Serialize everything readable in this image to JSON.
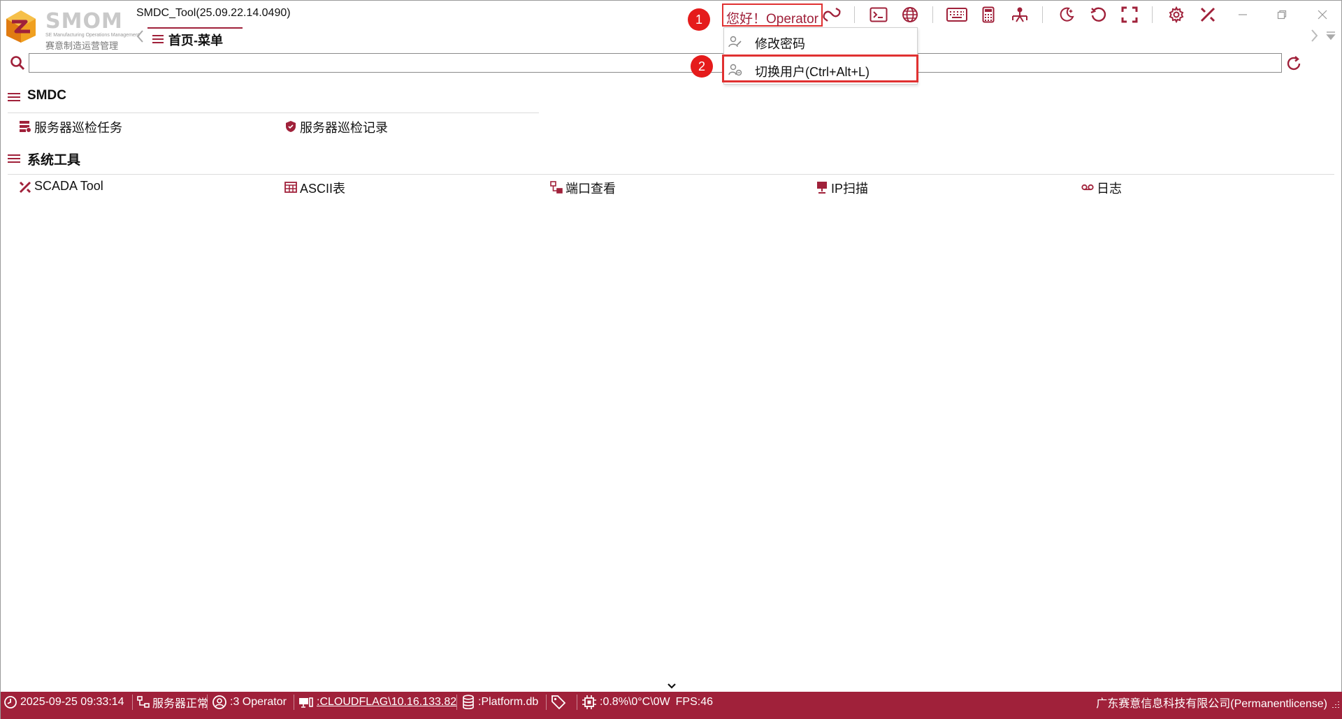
{
  "window": {
    "app_title": "SMDC_Tool(25.09.22.14.0490)",
    "brand_text": "SMOM",
    "brand_sub": "SE Manufacturing Operations Management",
    "brand_cn": "赛意制造运营管理",
    "accent_color": "#a0213a",
    "highlight_color": "#e03131",
    "controls": [
      "minimize-icon",
      "restore-icon",
      "close-icon"
    ]
  },
  "tabs": [
    {
      "label": "首页-菜单",
      "active": true
    }
  ],
  "header": {
    "greeting": "您好！Operator",
    "toolbar_icons": [
      "link-icon",
      "terminal-icon",
      "globe-icon",
      "keyboard-icon",
      "calculator-icon",
      "network-icon",
      "moon-icon",
      "undo-icon",
      "fullscreen-icon",
      "gear-icon",
      "tools-icon"
    ]
  },
  "annotations": {
    "step1": "1",
    "step2": "2"
  },
  "user_menu": {
    "items": [
      {
        "label": "修改密码",
        "icon": "edit-user-icon"
      },
      {
        "label": "切换用户(Ctrl+Alt+L)",
        "icon": "switch-user-icon",
        "highlighted": true
      }
    ]
  },
  "search": {
    "value": "",
    "placeholder": ""
  },
  "sections": [
    {
      "title": "SMDC",
      "items": [
        {
          "label": "服务器巡检任务",
          "icon": "server-task-icon"
        },
        {
          "label": "服务器巡检记录",
          "icon": "shield-icon"
        }
      ]
    },
    {
      "title": "系统工具",
      "items": [
        {
          "label": "SCADA Tool",
          "icon": "tools-icon"
        },
        {
          "label": "ASCII表",
          "icon": "table-icon"
        },
        {
          "label": "端口查看",
          "icon": "port-icon"
        },
        {
          "label": "IP扫描",
          "icon": "monitor-icon"
        },
        {
          "label": "日志",
          "icon": "tape-icon"
        }
      ]
    }
  ],
  "statusbar": {
    "datetime": "2025-09-25 09:33:14",
    "server_status": "服务器正常",
    "user": ":3 Operator",
    "host": ":CLOUDFLAG\\10.16.133.82",
    "database": ":Platform.db",
    "metrics": ":0.8%\\0°C\\0W",
    "fps": "FPS:46",
    "company": "广东赛意信息科技有限公司(Permanentlicense)"
  }
}
